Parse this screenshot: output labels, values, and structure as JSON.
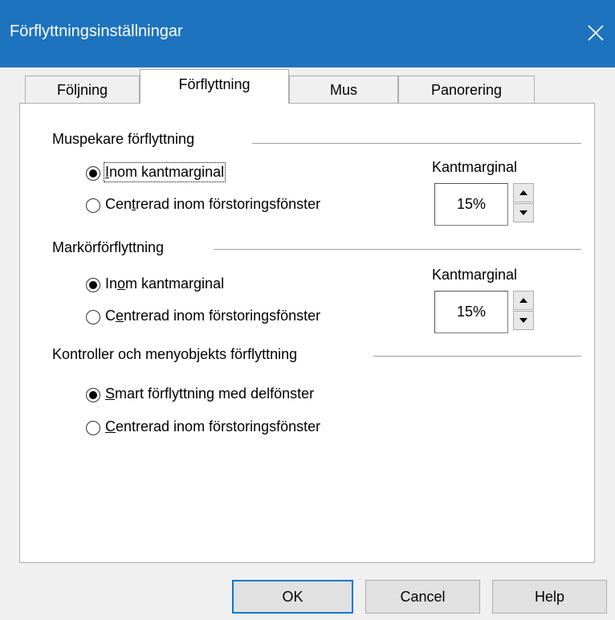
{
  "window": {
    "title": "Förflyttningsinställningar"
  },
  "tabs": [
    {
      "label": "Följning",
      "active": false
    },
    {
      "label": "Förflyttning",
      "active": true
    },
    {
      "label": "Mus",
      "active": false
    },
    {
      "label": "Panorering",
      "active": false
    }
  ],
  "mouse_pointer": {
    "group_label": "Muspekare förflyttning",
    "options": [
      {
        "label_pre": "",
        "label_ul": "I",
        "label_post": "nom kantmarginal",
        "checked": true
      },
      {
        "label_pre": "Cen",
        "label_ul": "t",
        "label_post": "rerad inom förstoringsfönster",
        "checked": false
      }
    ],
    "margin_label": "Kantmarginal",
    "margin_value": "15%"
  },
  "cursor": {
    "group_label": "Markörförflyttning",
    "options": [
      {
        "label_pre": "In",
        "label_ul": "o",
        "label_post": "m kantmarginal",
        "checked": true
      },
      {
        "label_pre": "C",
        "label_ul": "e",
        "label_post": "ntrerad inom förstoringsfönster",
        "checked": false
      }
    ],
    "margin_label": "Kantmarginal",
    "margin_value": "15%"
  },
  "controls": {
    "group_label": "Kontroller och menyobjekts förflyttning",
    "options": [
      {
        "label_pre": "",
        "label_ul": "S",
        "label_post": "mart förflyttning med delfönster",
        "checked": true
      },
      {
        "label_pre": "",
        "label_ul": "C",
        "label_post": "entrerad inom förstoringsfönster",
        "checked": false
      }
    ]
  },
  "buttons": {
    "ok": "OK",
    "cancel": "Cancel",
    "help": "Help"
  },
  "colors": {
    "titlebar": "#1e73be",
    "focus_border": "#0078d7"
  }
}
